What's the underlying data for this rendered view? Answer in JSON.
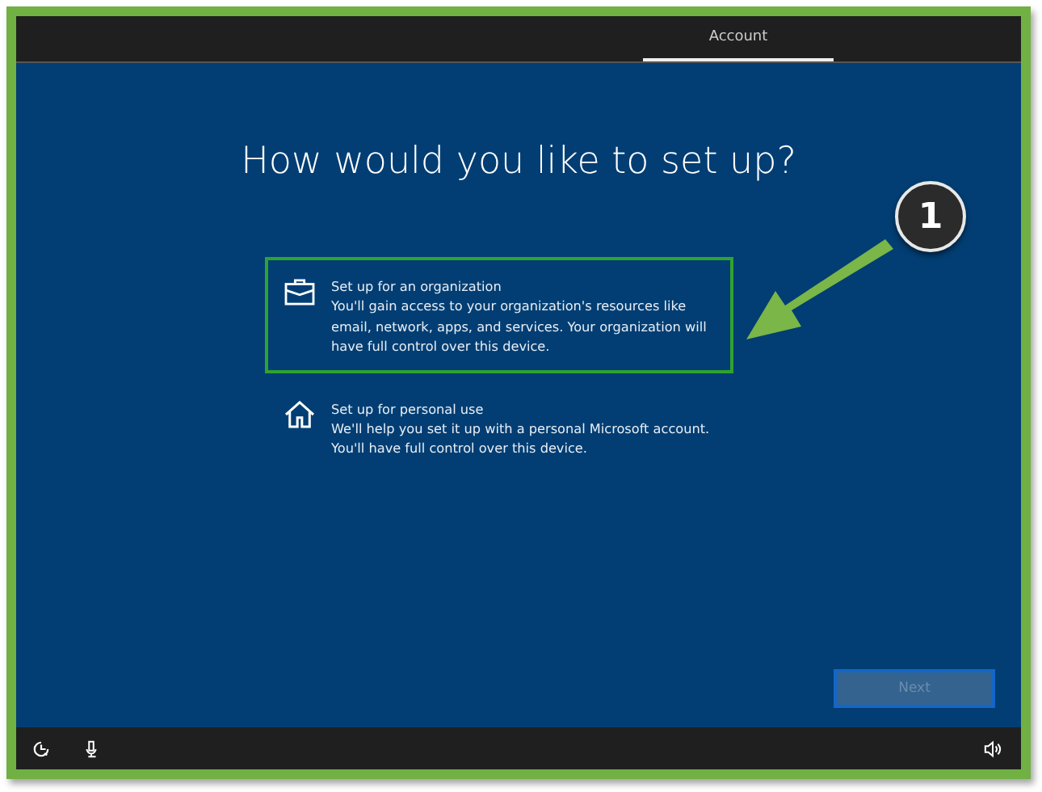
{
  "tabs": [
    {
      "label": "Account",
      "selected": true
    }
  ],
  "title": "How would you like to set up?",
  "options": [
    {
      "kind": "work",
      "title": "Set up for an organization",
      "description": "You'll gain access to your organization's resources like email, network, apps, and services. Your organization will have full control over this device.",
      "selected": true
    },
    {
      "kind": "home",
      "title": "Set up for personal use",
      "description": "We'll help you set it up with a personal Microsoft account. You'll have full control over this device.",
      "selected": false
    }
  ],
  "next_button": {
    "label": "Next",
    "disabled": true
  },
  "annotation": {
    "label": "1"
  }
}
